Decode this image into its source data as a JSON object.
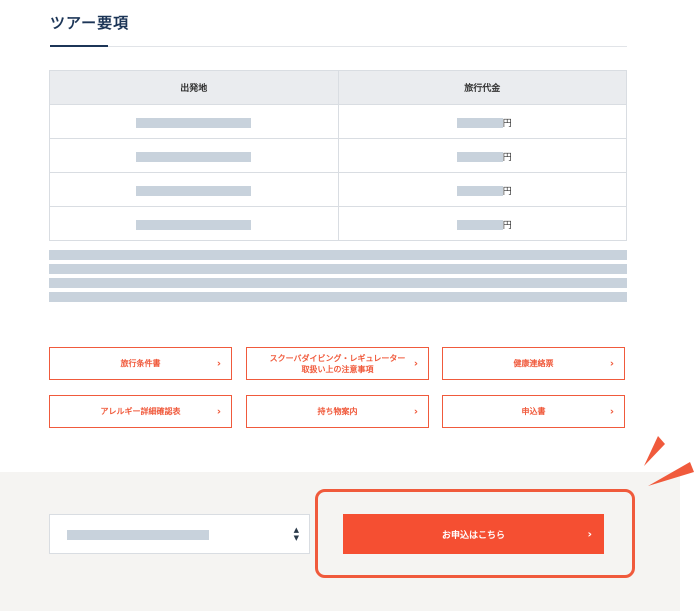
{
  "section": {
    "title": "ツアー要項"
  },
  "table": {
    "headers": [
      "出発地",
      "旅行代金"
    ],
    "price_unit": "円",
    "row_count_visible": 4
  },
  "links": [
    {
      "label": "旅行条件書"
    },
    {
      "label": "スクーバダイビング・レギュレーター取扱い上の注意事項"
    },
    {
      "label": "健康連絡票"
    },
    {
      "label": "アレルギー詳細確認表"
    },
    {
      "label": "持ち物案内"
    },
    {
      "label": "申込書"
    }
  ],
  "apply": {
    "button_label": "お申込はこちら"
  },
  "colors": {
    "accent": "#f05a3c",
    "apply_button": "#f54f32",
    "title": "#1c3557",
    "placeholder": "#c8d2dc",
    "apply_area_bg": "#f5f4f2"
  },
  "icons": {
    "link_chevron": "chevron-right-icon",
    "select_arrows": "sort-arrows-icon",
    "burst": "attention-burst-icon"
  }
}
